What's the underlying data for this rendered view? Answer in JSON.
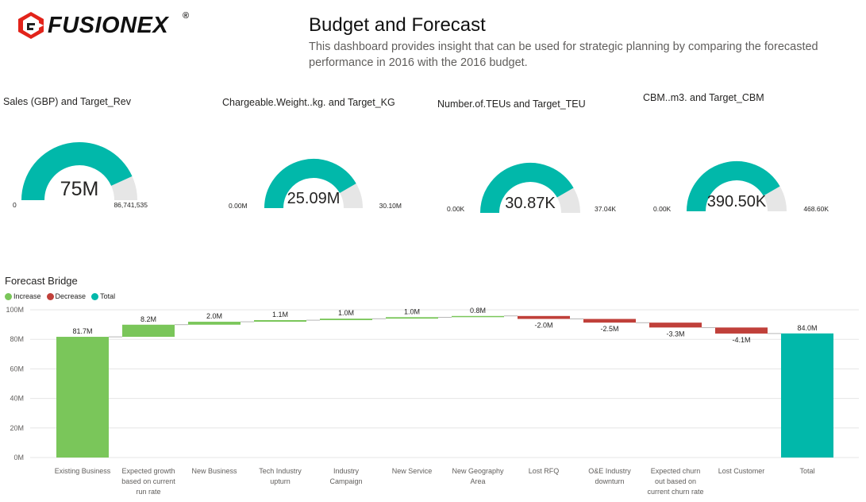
{
  "header": {
    "logo_text": "FUSIONEX",
    "logo_mark": "®",
    "title": "Budget and Forecast",
    "subtitle": "This dashboard provides insight that can be used for strategic planning by comparing the forecasted performance in 2016 with the 2016 budget."
  },
  "colors": {
    "teal": "#01b8aa",
    "gauge_track": "#e6e6e6",
    "increase": "#7ac65a",
    "decrease": "#c0403a",
    "total": "#01b8aa",
    "logo_red": "#e2231a"
  },
  "gauges": [
    {
      "title": "Sales (GBP) and Target_Rev",
      "value_label": "75M",
      "min_label": "0",
      "max_label": "86,741,535",
      "value": 75000000,
      "min": 0,
      "max": 86741535
    },
    {
      "title": "Chargeable.Weight..kg. and Target_KG",
      "value_label": "25.09M",
      "min_label": "0.00M",
      "max_label": "30.10M",
      "value": 25.09,
      "min": 0,
      "max": 30.1
    },
    {
      "title": "Number.of.TEUs and Target_TEU",
      "value_label": "30.87K",
      "min_label": "0.00K",
      "max_label": "37.04K",
      "value": 30.87,
      "min": 0,
      "max": 37.04
    },
    {
      "title": "CBM..m3. and Target_CBM",
      "value_label": "390.50K",
      "min_label": "0.00K",
      "max_label": "468.60K",
      "value": 390.5,
      "min": 0,
      "max": 468.6
    }
  ],
  "bridge": {
    "title": "Forecast Bridge",
    "legend": [
      {
        "label": "Increase",
        "color": "#7ac65a"
      },
      {
        "label": "Decrease",
        "color": "#c0403a"
      },
      {
        "label": "Total",
        "color": "#01b8aa"
      }
    ]
  },
  "chart_data": {
    "type": "waterfall",
    "title": "Forecast Bridge",
    "ylim": [
      0,
      100
    ],
    "y_unit": "M",
    "y_ticks": [
      "0M",
      "20M",
      "40M",
      "60M",
      "80M",
      "100M"
    ],
    "grid": true,
    "legend_position": "top-left",
    "categories": [
      [
        "Existing Business"
      ],
      [
        "Expected growth",
        "based on current",
        "run rate"
      ],
      [
        "New Business"
      ],
      [
        "Tech Industry",
        "upturn"
      ],
      [
        "Industry",
        "Campaign"
      ],
      [
        "New Service"
      ],
      [
        "New Geography",
        "Area"
      ],
      [
        "Lost RFQ"
      ],
      [
        "O&E Industry",
        "downturn"
      ],
      [
        "Expected churn",
        "out based on",
        "current churn rate"
      ],
      [
        "Lost Customer"
      ],
      [
        "Total"
      ]
    ],
    "values": [
      81.7,
      8.2,
      2.0,
      1.1,
      1.0,
      1.0,
      0.8,
      -2.0,
      -2.5,
      -3.3,
      -4.1,
      84.0
    ],
    "kinds": [
      "increase",
      "increase",
      "increase",
      "increase",
      "increase",
      "increase",
      "increase",
      "decrease",
      "decrease",
      "decrease",
      "decrease",
      "total"
    ],
    "data_labels": [
      "81.7M",
      "8.2M",
      "2.0M",
      "1.1M",
      "1.0M",
      "1.0M",
      "0.8M",
      "-2.0M",
      "-2.5M",
      "-3.3M",
      "-4.1M",
      "84.0M"
    ]
  }
}
